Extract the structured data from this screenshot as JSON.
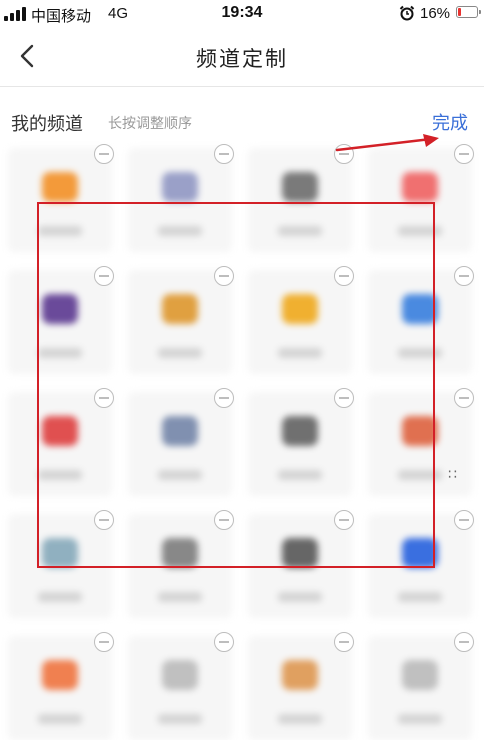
{
  "status_bar": {
    "carrier": "中国移动",
    "network": "4G",
    "time": "19:34",
    "battery_text": "16%",
    "battery_level": 0.16,
    "battery_color": "#e8322f",
    "icons": [
      "signal-icon",
      "alarm-icon",
      "battery-icon"
    ]
  },
  "nav": {
    "title": "频道定制",
    "back_icon": "back-chevron-icon"
  },
  "section": {
    "title": "我的频道",
    "hint": "长按调整顺序",
    "done_label": "完成"
  },
  "edge_mark": "∷",
  "colors": {
    "accent": "#3a6fd8",
    "annotation_red": "#d32027"
  },
  "channels": [
    {
      "icon_color": "#f39a3a"
    },
    {
      "icon_color": "#9aa0c8"
    },
    {
      "icon_color": "#7a7a7a"
    },
    {
      "icon_color": "#f07070"
    },
    {
      "icon_color": "#6a4a9a"
    },
    {
      "icon_color": "#e0a040"
    },
    {
      "icon_color": "#f0b030"
    },
    {
      "icon_color": "#4a8ae0"
    },
    {
      "icon_color": "#e05050"
    },
    {
      "icon_color": "#8090b0"
    },
    {
      "icon_color": "#707070"
    },
    {
      "icon_color": "#e07050"
    },
    {
      "icon_color": "#90b0c0"
    },
    {
      "icon_color": "#888888"
    },
    {
      "icon_color": "#666666"
    },
    {
      "icon_color": "#3a6fe0"
    },
    {
      "icon_color": "#f08050"
    },
    {
      "icon_color": "#c0c0c0"
    },
    {
      "icon_color": "#e0a060"
    },
    {
      "icon_color": "#c0c0c0"
    }
  ]
}
